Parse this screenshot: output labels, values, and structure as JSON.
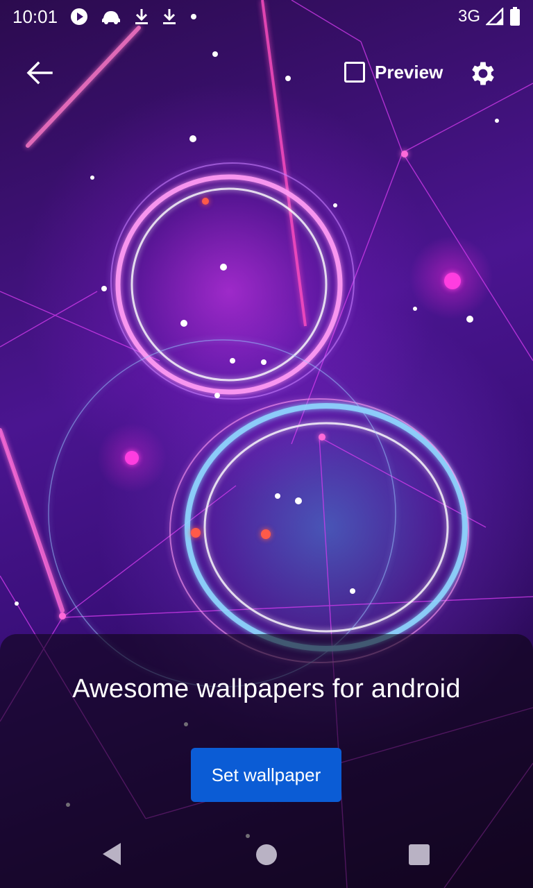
{
  "status_bar": {
    "time": "10:01",
    "network": "3G",
    "left_icons": [
      "play-icon",
      "car-icon",
      "download-icon",
      "download-icon",
      "dot-icon"
    ],
    "right_icons": [
      "signal-icon",
      "battery-icon"
    ]
  },
  "toolbar": {
    "back_icon": "arrow-left-icon",
    "preview_label": "Preview",
    "preview_checked": false,
    "settings_icon": "gear-icon"
  },
  "panel": {
    "title": "Awesome wallpapers for android",
    "button_label": "Set wallpaper",
    "button_color": "#0b5cd5"
  },
  "nav_bar": {
    "icons": [
      "nav-back-icon",
      "nav-home-icon",
      "nav-recents-icon"
    ]
  },
  "colors": {
    "background_primary": "#4a1590",
    "accent_magenta": "#e63cff"
  }
}
